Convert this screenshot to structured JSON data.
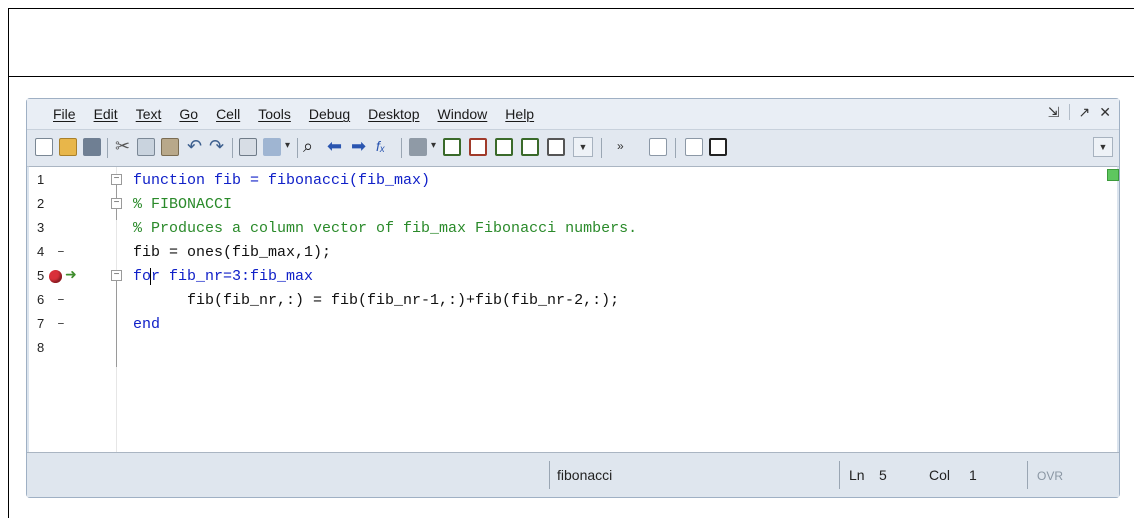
{
  "menubar": {
    "items": [
      "File",
      "Edit",
      "Text",
      "Go",
      "Cell",
      "Tools",
      "Debug",
      "Desktop",
      "Window",
      "Help"
    ],
    "window_controls": [
      "⇲",
      "↗",
      "✕"
    ]
  },
  "toolbar": {
    "icons": [
      "new-file-icon",
      "open-folder-icon",
      "save-icon",
      "cut-icon",
      "copy-icon",
      "paste-icon",
      "undo-icon",
      "redo-icon",
      "print-icon",
      "tools-icon",
      "find-icon",
      "back-icon",
      "forward-icon",
      "function-icon",
      "bookmark-icon",
      "breakpoint-set-icon",
      "step-icon",
      "step-in-icon",
      "step-out-icon",
      "continue-icon",
      "stack-dropdown",
      "cell-icon",
      "layout-icon"
    ],
    "fx_label": "fₓ"
  },
  "editor": {
    "lines": [
      {
        "num": "1",
        "code": "function fib = fibonacci(fib_max)"
      },
      {
        "num": "2",
        "code": "% FIBONACCI"
      },
      {
        "num": "3",
        "code": "% Produces a column vector of fib_max Fibonacci numbers."
      },
      {
        "num": "4",
        "code": "fib = ones(fib_max,1);"
      },
      {
        "num": "5",
        "code": "for fib_nr=3:fib_max"
      },
      {
        "num": "6",
        "code": "fib(fib_nr,:) = fib(fib_nr-1,:)+fib(fib_nr-2,:);"
      },
      {
        "num": "7",
        "code": "end"
      },
      {
        "num": "8",
        "code": ""
      }
    ],
    "dash": "–"
  },
  "statusbar": {
    "function_name": "fibonacci",
    "ln_label": "Ln",
    "ln_value": "5",
    "col_label": "Col",
    "col_value": "1",
    "mode": "OVR"
  },
  "colors": {
    "keyword": "#1020c8",
    "comment": "#2a8a2a",
    "breakpoint": "#d9303a"
  }
}
